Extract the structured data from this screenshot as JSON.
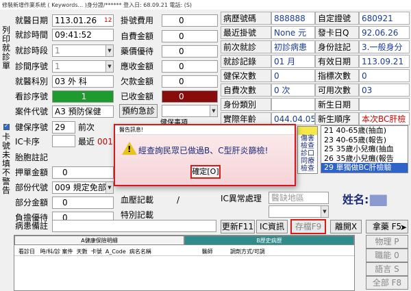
{
  "window": {
    "title": "修裝新增作業系統 ( Keywords...  )身分證/******   登入日: 68.09.21 電話: (S)"
  },
  "side_labels": {
    "print_label": "列印就診單",
    "card_warn_label": "卡號未填不警告"
  },
  "left_form": {
    "visit_date": {
      "label": "就醫日期",
      "value": "113.01.26",
      "tag": "12"
    },
    "visit_time": {
      "label": "就診時間",
      "value": "09:41:52"
    },
    "visit_period": {
      "label": "就診時段",
      "value": "1"
    },
    "clinic_room": {
      "label": "診間序號",
      "value": "1"
    },
    "dept": {
      "label": "就醫科別",
      "value": "03 外  科"
    },
    "queue_no": {
      "label": "看診序號",
      "value": "1"
    },
    "case_code": {
      "label": "案件代號",
      "value": "A3 預防保健"
    },
    "insure_seq": {
      "label": "健保序號",
      "value": "29",
      "suffix": "前次"
    },
    "ic_card": {
      "label": "IC卡序",
      "recent_label": "最近",
      "recent_value": "001"
    },
    "fetal": {
      "label": "胎胞註記"
    },
    "deposit": {
      "label": "押單金額",
      "value": "0"
    },
    "part_code": {
      "label": "部份代號",
      "value": "009 規定免部"
    },
    "part_amount": {
      "label": "部分金額",
      "value": "0"
    },
    "burden": {
      "label": "負擔優待",
      "value": "0"
    },
    "note": {
      "label": "病患備註"
    }
  },
  "mid_form": {
    "reg_fee": {
      "label": "掛號費用",
      "value": "0"
    },
    "self_pay": {
      "label": "自費金額",
      "value": "0"
    },
    "drug_discount": {
      "label": "藥價優待",
      "value": "0"
    },
    "receivable": {
      "label": "應收金額",
      "value": "0"
    },
    "owed": {
      "label": "欠款金額",
      "value": "0"
    },
    "received": {
      "label": "已收金額",
      "value": "0"
    },
    "appointment_button": "預約急診",
    "health_item": "健保事項",
    "blood_record": {
      "label": "血壓記載",
      "value": "/"
    },
    "special_record": {
      "label": "特別記載"
    }
  },
  "right_table": {
    "rows": [
      {
        "l1": "病歷號碼",
        "v1": "888888",
        "l2": "自定證號",
        "v2": "680921"
      },
      {
        "l1": "最近掛號",
        "v1": "None 元",
        "l2": "發卡日Q",
        "v2": "92.06.26"
      },
      {
        "l1": "前次就診",
        "v1": "初診病患",
        "l2": "身份註記",
        "v2": "3.一般身分"
      },
      {
        "l1": "就診記錄",
        "v1": "01    月",
        "l2": "有效日期",
        "v2": "113.09.21"
      },
      {
        "l1": "健保次數",
        "v1": "0",
        "l2": "指標次數",
        "v2": "0"
      },
      {
        "l1": "自費次數",
        "v1": "0 次",
        "l2": "可用次數",
        "v2": "03"
      },
      {
        "l1": "身份類別",
        "v1": "",
        "l2": "新生日期",
        "v2": ""
      },
      {
        "l1": "實際年齡",
        "v1": "044.04.05",
        "l2": "新生順序",
        "v2": "本次BC肝檢"
      }
    ]
  },
  "screening_list": {
    "partial_labels": [
      "傷害",
      "檢查",
      "診口",
      "同療",
      "檢查"
    ],
    "items": [
      "21 40-65歲(抽血)",
      "23 40-65歲(報告)",
      "25 35歲小兒癱(抽血",
      "26 35歲小兒癱(報告",
      "29 單獨做BC肝檢驗"
    ],
    "selected_index": 4
  },
  "ic_exception": {
    "label": "IC異常處理",
    "value": "醫缺地區"
  },
  "patient_name": {
    "label": "姓名:",
    "value": "▇▇"
  },
  "action_buttons": {
    "update": "更新F11",
    "ic_info": "IC資訊",
    "save": "存檔F9",
    "exit": "離開X",
    "take_drug": "拿藥 F5",
    "physio": "物理 P",
    "func": "職能 0",
    "speech": "語言 S",
    "all": "全部 F8"
  },
  "bottom_tabs": {
    "tab_a": "A健康保險明細",
    "tab_b": "B歷史病歷"
  },
  "bottom_columns": "看診日   時/科/診 案件  天數  卡號  A_Code  病名名稱                             醫師          調劑方式/可調",
  "dialog": {
    "title": "醫告訊息!",
    "message": "經查詢民眾已做過B、C型肝炎篩檢!",
    "ok_label": "確定[O]"
  },
  "colors": {
    "alert_red": "#d91818",
    "queue_green": "#1f9a2e",
    "received_maroon": "#8a0b0b",
    "list_selected": "#2e63c9"
  }
}
